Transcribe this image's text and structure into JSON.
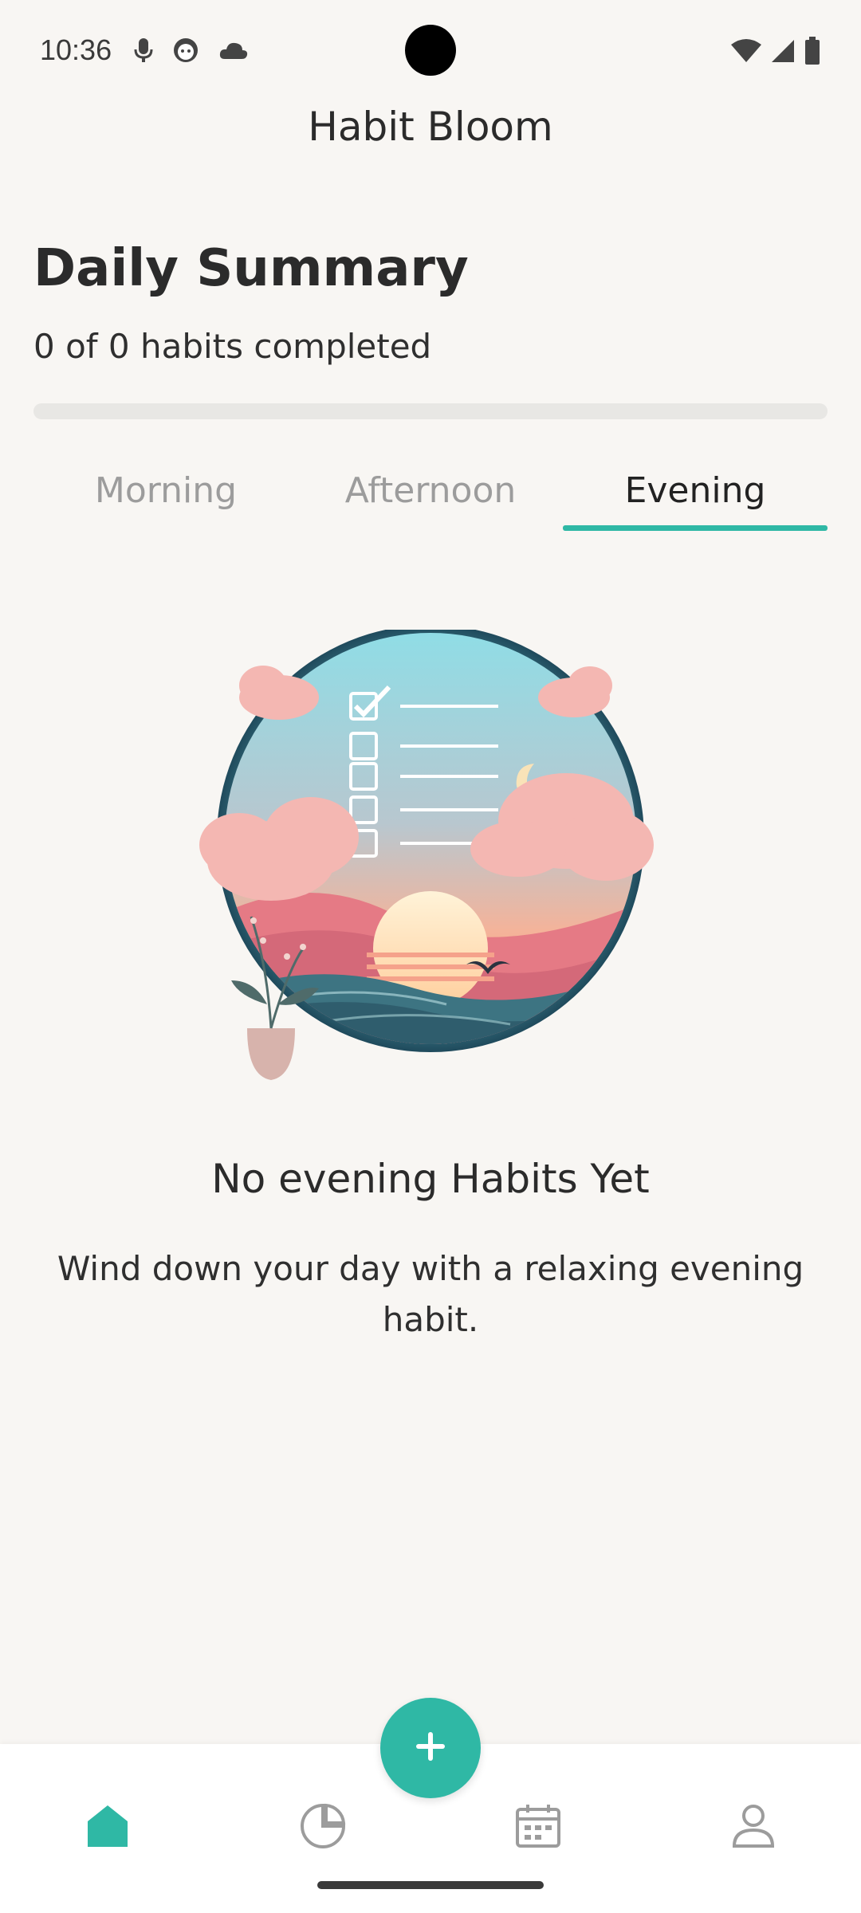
{
  "status_bar": {
    "time": "10:36",
    "left_icons": [
      "mic-icon",
      "face-icon",
      "cloud-icon"
    ],
    "right_icons": [
      "wifi-icon",
      "cell-signal-icon",
      "battery-icon"
    ]
  },
  "app": {
    "title": "Habit Bloom"
  },
  "summary": {
    "title": "Daily Summary",
    "subtitle": "0 of 0 habits completed",
    "progress": 0
  },
  "tabs": [
    {
      "label": "Morning",
      "active": false
    },
    {
      "label": "Afternoon",
      "active": false
    },
    {
      "label": "Evening",
      "active": true
    }
  ],
  "empty_state": {
    "title": "No evening Habits Yet",
    "description": "Wind down your day with a relaxing evening habit.",
    "illustration": "evening-sunset-checklist-illustration"
  },
  "bottom_nav": {
    "items": [
      "home-icon",
      "stats-pie-icon",
      "calendar-icon",
      "profile-icon"
    ],
    "active": "home-icon",
    "fab_icon": "plus-icon"
  },
  "colors": {
    "accent": "#2fb8a5",
    "background": "#f8f6f3",
    "inactive": "#9c9c9c"
  }
}
